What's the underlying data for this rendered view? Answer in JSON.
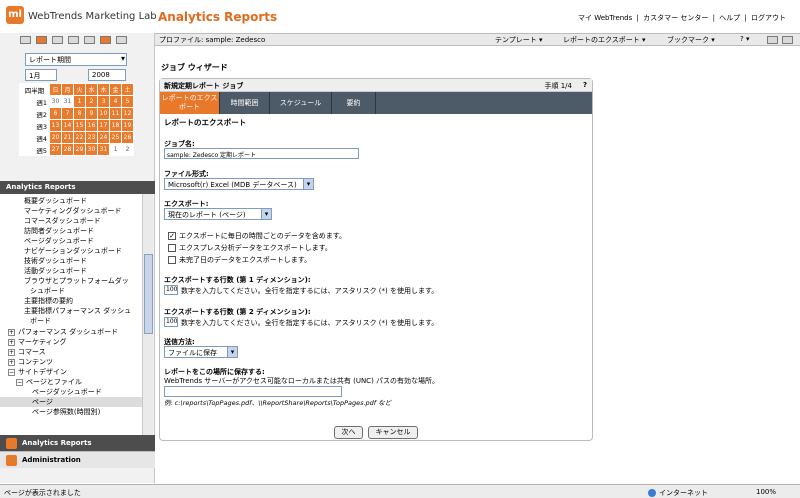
{
  "header": {
    "logo": "ml",
    "brand": "WebTrends Marketing Lab",
    "app_title": "Analytics Reports",
    "links": [
      "マイ WebTrends",
      "|",
      "カスタマー センター",
      "|",
      "ヘルプ",
      "|",
      "ログアウト"
    ]
  },
  "sidebar": {
    "range_select": "レポート期間",
    "month": "1月",
    "year": "2008",
    "calendar": {
      "week_header": "四半期",
      "days": [
        "日",
        "月",
        "火",
        "水",
        "木",
        "金",
        "土"
      ],
      "rows": [
        {
          "week": "週1",
          "cells": [
            "30",
            "31",
            "1",
            "2",
            "3",
            "4",
            "5"
          ]
        },
        {
          "week": "週2",
          "cells": [
            "6",
            "7",
            "8",
            "9",
            "10",
            "11",
            "12"
          ]
        },
        {
          "week": "週3",
          "cells": [
            "13",
            "14",
            "15",
            "16",
            "17",
            "18",
            "19"
          ]
        },
        {
          "week": "週4",
          "cells": [
            "20",
            "21",
            "22",
            "23",
            "24",
            "25",
            "26"
          ]
        },
        {
          "week": "週5",
          "cells": [
            "27",
            "28",
            "29",
            "30",
            "31",
            "1",
            "2"
          ]
        }
      ]
    },
    "nav_title": "Analytics Reports",
    "nav_items": [
      "概要ダッシュボード",
      "マーケティングダッシュボード",
      "コマースダッシュボード",
      "訪問者ダッシュボード",
      "ページダッシュボード",
      "ナビゲーションダッシュボード",
      "技術ダッシュボード",
      "活動ダッシュボード",
      "ブラウザとプラットフォームダッ",
      "シュボード",
      "主要指標の要約",
      "主要指標パフォーマンス ダッシュ",
      "ボード"
    ],
    "tree_items": [
      "パフォーマンス ダッシュボード",
      "マーケティング",
      "コマース",
      "コンテンツ",
      "サイトデザイン",
      "ページとファイル",
      "ページダッシュボード",
      "ページ",
      "ページ参照数(時間別)"
    ],
    "bottom_analytics": "Analytics Reports",
    "bottom_admin": "Administration"
  },
  "profile_bar": {
    "profile": "プロファイル: sample: Zedesco",
    "menus": [
      "テンプレート ▾",
      "レポートのエクスポート ▾",
      "ブックマーク ▾",
      "? ▾"
    ]
  },
  "wizard": {
    "title": "ジョブ ウィザード",
    "panel_title": "新規定期レポート ジョブ",
    "step": "手順 1/4",
    "help": "?",
    "tabs": [
      "レポートのエクスポート",
      "時間範囲",
      "スケジュール",
      "要約"
    ],
    "section": "レポートのエクスポート",
    "job_name_label": "ジョブ名:",
    "job_name_value": "sample: Zedesco 定期レポート",
    "file_format_label": "ファイル形式:",
    "file_format_value": "Microsoft(r) Excel (MDB データベース)",
    "export_label": "エクスポート:",
    "export_value": "現在のレポート (ページ)",
    "checkbox1": "エクスポートに毎日の時間ごとのデータを含めます。",
    "checkbox2": "エクスプレス分析データをエクスポートします。",
    "checkbox3": "未完了日のデータをエクスポートします。",
    "rows1_label": "エクスポートする行数 (第 1 ディメンション):",
    "rows1_value": "100",
    "rows1_hint": "数字を入力してください。全行を指定するには、アスタリスク (*) を使用します。",
    "rows2_label": "エクスポートする行数 (第 2 ディメンション):",
    "rows2_value": "100",
    "rows2_hint": "数字を入力してください。全行を指定するには、アスタリスク (*) を使用します。",
    "send_label": "送信方法:",
    "send_value": "ファイルに保存",
    "save_label": "レポートをこの場所に保存する:",
    "save_hint": "WebTrends サーバーがアクセス可能なローカルまたは共有 (UNC) パスの有効な場所。",
    "save_value": "",
    "example": "例: c:\\reports\\TopPages.pdf、\\\\ReportShare\\Reports\\TopPages.pdf など",
    "next_button": "次へ",
    "cancel_button": "キャンセル"
  },
  "status_bar": {
    "text": "ページが表示されました",
    "zone": "インターネット",
    "zoom": "100%"
  }
}
